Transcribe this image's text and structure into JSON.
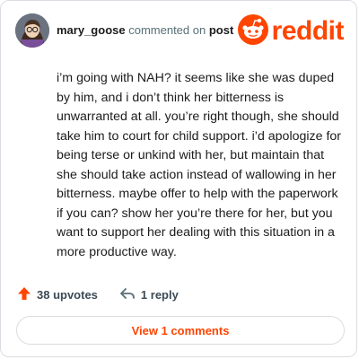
{
  "comment": {
    "username": "mary_goose",
    "verb": "commented on",
    "post_link": "post",
    "text": "i’m going with NAH? it seems like she was duped by him, and i don’t think her bitterness is unwarranted at all. you’re right though, she should take him to court for child support. i’d apologize for being terse or unkind with her, but maintain that she should take action instead of wallowing in her bitterness. maybe offer to help with the paperwork if you can? show her you’re there for her, but you want to support her dealing with this situation in a more productive way."
  },
  "brand": {
    "wordmark": "reddit",
    "accent": "#ff4500"
  },
  "actions": {
    "upvotes": "38 upvotes",
    "replies": "1 reply"
  },
  "footer": {
    "view_comments": "View 1 comments"
  },
  "icons": {
    "avatar": "user-avatar",
    "logo": "reddit-snoo-icon",
    "upvote": "upvote-arrow-icon",
    "reply": "reply-arrow-icon"
  }
}
